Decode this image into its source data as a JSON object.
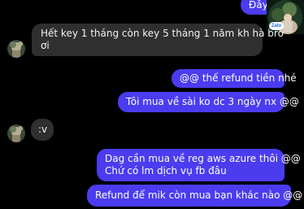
{
  "messages": [
    {
      "direction": "out",
      "text": "Đây b"
    },
    {
      "direction": "in",
      "lines": [
        "Hết key 1 tháng còn key 5 tháng 1 năm kh hà bro",
        "ơi"
      ]
    },
    {
      "direction": "out",
      "text": "@@ thế refund tiền nhé"
    },
    {
      "direction": "out",
      "text": "Tôi mua về sài ko dc 3 ngày nx @@"
    },
    {
      "direction": "in",
      "text": ":v"
    },
    {
      "direction": "out",
      "lines": [
        "Dag cần mua về reg aws azure thôi  @@",
        "Chứ có lm dịch vụ fb đâu"
      ]
    },
    {
      "direction": "out",
      "text": "Refund để mik còn mua bạn khác nào @@"
    }
  ],
  "profile_badge": {
    "label": "Zalo"
  },
  "colors": {
    "background": "#000000",
    "outgoing_bubble": "#4b3cf0",
    "incoming_bubble": "#2f2f2f",
    "text": "#ffffff"
  }
}
